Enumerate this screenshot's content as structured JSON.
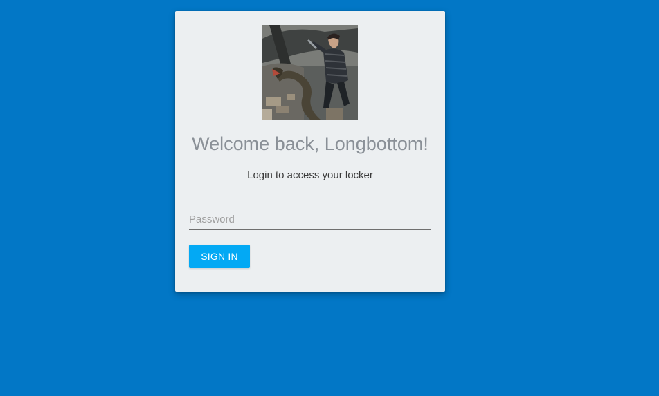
{
  "login_card": {
    "avatar_alt": "Neville Longbottom fighting a giant snake",
    "title": "Welcome back, Longbottom!",
    "subtitle": "Login to access your locker",
    "password_placeholder": "Password",
    "password_value": "",
    "sign_in_label": "SIGN IN"
  },
  "colors": {
    "background": "#0277c6",
    "card": "#eceff1",
    "button": "#03a9f4",
    "title_text": "#8a9097"
  }
}
